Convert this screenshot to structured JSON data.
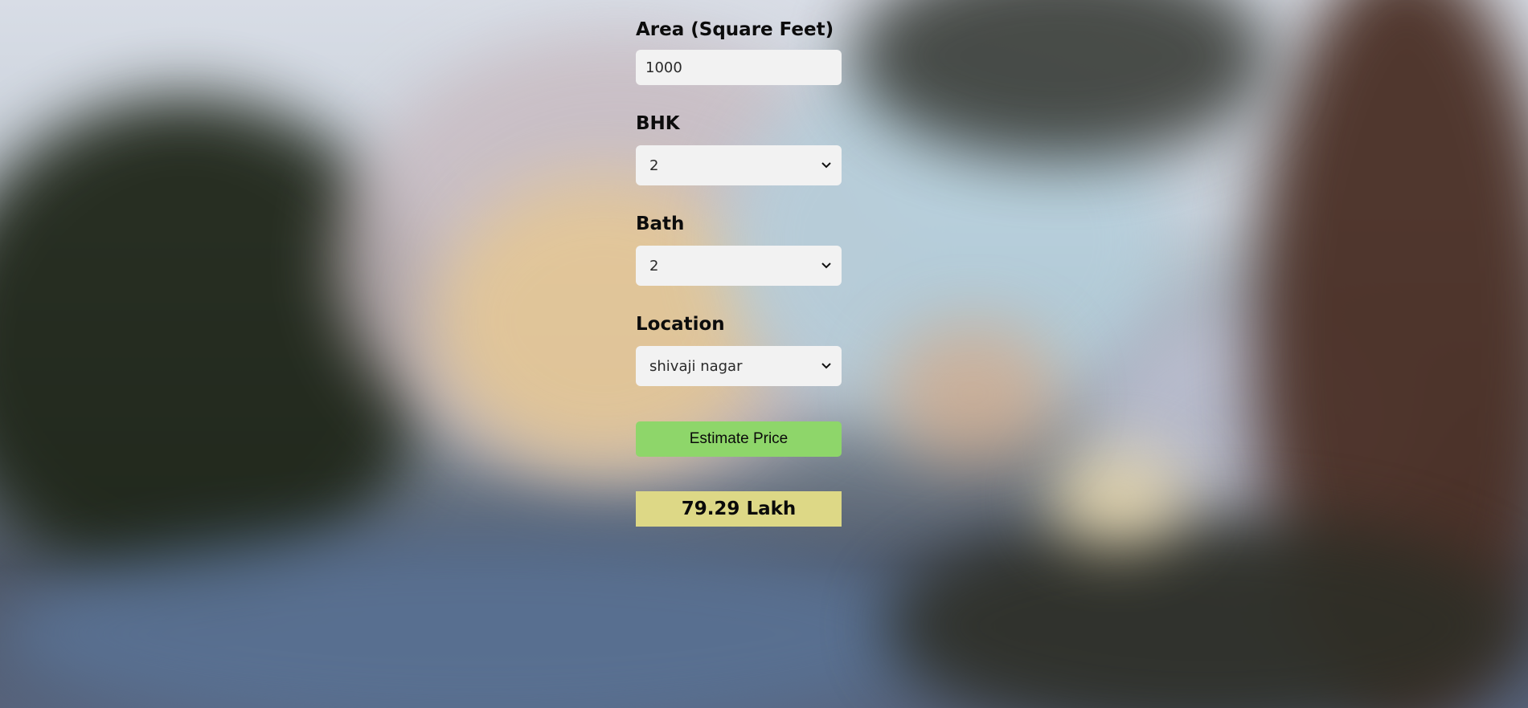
{
  "form": {
    "area": {
      "label": "Area (Square Feet)",
      "value": "1000"
    },
    "bhk": {
      "label": "BHK",
      "selected": "2"
    },
    "bath": {
      "label": "Bath",
      "selected": "2"
    },
    "location": {
      "label": "Location",
      "selected": "shivaji nagar"
    },
    "estimate_button": "Estimate Price",
    "result": "79.29 Lakh"
  },
  "colors": {
    "button": "#8ed66a",
    "result_background": "#ddd886",
    "field_background": "#f2f2f2"
  },
  "icons": {
    "select_arrow": "chevron-down-icon"
  }
}
